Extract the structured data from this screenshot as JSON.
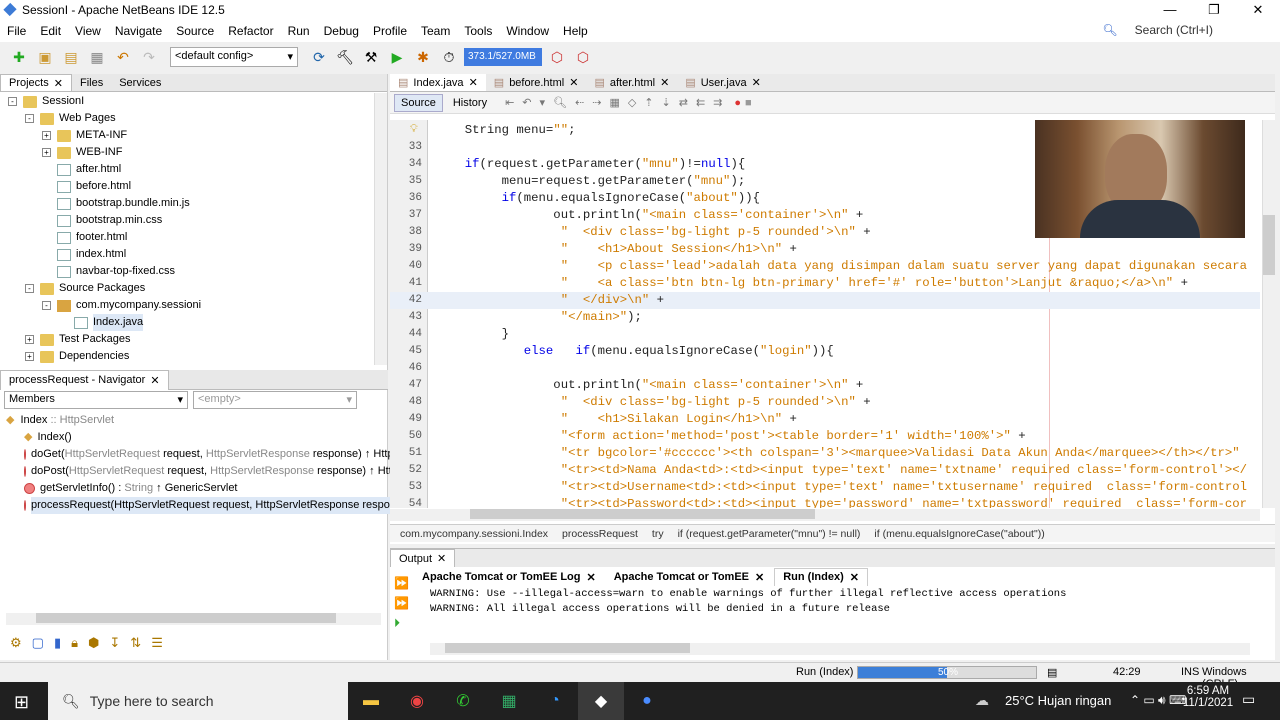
{
  "window": {
    "title": "SessionI - Apache NetBeans IDE 12.5"
  },
  "menu": [
    "File",
    "Edit",
    "View",
    "Navigate",
    "Source",
    "Refactor",
    "Run",
    "Debug",
    "Profile",
    "Team",
    "Tools",
    "Window",
    "Help"
  ],
  "search_placeholder": "Search (Ctrl+I)",
  "toolbar": {
    "config": "<default config>",
    "memory": "373.1/527.0MB"
  },
  "left_tabs": [
    "Projects",
    "Files",
    "Services"
  ],
  "project_tree": [
    {
      "label": "SessionI",
      "level": 0,
      "icon": "project-icon",
      "exp": "-"
    },
    {
      "label": "Web Pages",
      "level": 1,
      "icon": "folder-icon",
      "exp": "-"
    },
    {
      "label": "META-INF",
      "level": 2,
      "icon": "folder-icon",
      "exp": "+"
    },
    {
      "label": "WEB-INF",
      "level": 2,
      "icon": "folder-icon",
      "exp": "+"
    },
    {
      "label": "after.html",
      "level": 2,
      "icon": "file-icon"
    },
    {
      "label": "before.html",
      "level": 2,
      "icon": "file-icon"
    },
    {
      "label": "bootstrap.bundle.min.js",
      "level": 2,
      "icon": "file-icon"
    },
    {
      "label": "bootstrap.min.css",
      "level": 2,
      "icon": "file-icon"
    },
    {
      "label": "footer.html",
      "level": 2,
      "icon": "file-icon"
    },
    {
      "label": "index.html",
      "level": 2,
      "icon": "file-icon"
    },
    {
      "label": "navbar-top-fixed.css",
      "level": 2,
      "icon": "file-icon"
    },
    {
      "label": "Source Packages",
      "level": 1,
      "icon": "folder-icon",
      "exp": "-"
    },
    {
      "label": "com.mycompany.sessioni",
      "level": 2,
      "icon": "package-icon",
      "exp": "-"
    },
    {
      "label": "Index.java",
      "level": 3,
      "icon": "file-icon",
      "selected": true
    },
    {
      "label": "Test Packages",
      "level": 1,
      "icon": "folder-icon",
      "exp": "+"
    },
    {
      "label": "Dependencies",
      "level": 1,
      "icon": "folder-icon",
      "exp": "+"
    }
  ],
  "navigator": {
    "title": "processRequest - Navigator",
    "members_label": "Members",
    "filter": "<empty>",
    "root": {
      "name": "Index",
      "type": ":: HttpServlet"
    },
    "items": [
      {
        "name": "Index()",
        "params": "",
        "rest": ""
      },
      {
        "name": "doGet(",
        "params": "HttpServletRequest",
        "rest": " request, ",
        "params2": "HttpServletResponse",
        "rest2": " response) ↑ HttpServlet"
      },
      {
        "name": "doPost(",
        "params": "HttpServletRequest",
        "rest": " request, ",
        "params2": "HttpServletResponse",
        "rest2": " response) ↑ HttpServlet"
      },
      {
        "name": "getServletInfo() : ",
        "params": "String",
        "rest": " ↑ GenericServlet"
      },
      {
        "name": "processRequest(HttpServletRequest request, HttpServletResponse response)",
        "params": "",
        "rest": "",
        "selected": true
      }
    ]
  },
  "editor_tabs": [
    "Index.java",
    "before.html",
    "after.html",
    "User.java"
  ],
  "editor_modes": {
    "source": "Source",
    "history": "History"
  },
  "code": [
    {
      "n": "",
      "t": "  String menu=\"\";"
    },
    {
      "n": "33",
      "t": ""
    },
    {
      "n": "34",
      "t": "  if(request.getParameter(\"mnu\")!=null){"
    },
    {
      "n": "35",
      "t": "       menu=request.getParameter(\"mnu\");"
    },
    {
      "n": "36",
      "t": "       if(menu.equalsIgnoreCase(\"about\")){"
    },
    {
      "n": "37",
      "t": "              out.println(\"<main class='container'>\\n\" +"
    },
    {
      "n": "38",
      "t": "               \"  <div class='bg-light p-5 rounded'>\\n\" +"
    },
    {
      "n": "39",
      "t": "               \"    <h1>About Session</h1>\\n\" +"
    },
    {
      "n": "40",
      "t": "               \"    <p class='lead'>adalah data yang disimpan dalam suatu server yang dapat digunakan secara"
    },
    {
      "n": "41",
      "t": "               \"    <a class='btn btn-lg btn-primary' href='#' role='button'>Lanjut &raquo;</a>\\n\" +"
    },
    {
      "n": "42",
      "t": "               \"  </div>\\n\" +"
    },
    {
      "n": "43",
      "t": "               \"</main>\");"
    },
    {
      "n": "44",
      "t": "       }"
    },
    {
      "n": "45",
      "t": "          else   if(menu.equalsIgnoreCase(\"login\")){"
    },
    {
      "n": "46",
      "t": ""
    },
    {
      "n": "47",
      "t": "              out.println(\"<main class='container'>\\n\" +"
    },
    {
      "n": "48",
      "t": "               \"  <div class='bg-light p-5 rounded'>\\n\" +"
    },
    {
      "n": "49",
      "t": "               \"    <h1>Silakan Login</h1>\\n\" +"
    },
    {
      "n": "50",
      "t": "               \"<form action='method='post'><table border='1' width='100%'>\" +"
    },
    {
      "n": "51",
      "t": "               \"<tr bgcolor='#cccccc'><th colspan='3'><marquee>Validasi Data Akun Anda</marquee></th></tr>\""
    },
    {
      "n": "52",
      "t": "               \"<tr><td>Nama Anda<td>:<td><input type='text' name='txtname' required class='form-control'></"
    },
    {
      "n": "53",
      "t": "               \"<tr><td>Username<td>:<td><input type='text' name='txtusername' required  class='form-control"
    },
    {
      "n": "54",
      "t": "               \"<tr><td>Password<td>:<td><input type='password' name='txtpassword' required  class='form-cor"
    }
  ],
  "breadcrumb": [
    "com.mycompany.sessioni.Index",
    "processRequest",
    "try",
    "if (request.getParameter(\"mnu\") != null)",
    "if (menu.equalsIgnoreCase(\"about\"))"
  ],
  "output": {
    "title": "Output",
    "tabs": [
      "Apache Tomcat or TomEE Log",
      "Apache Tomcat or TomEE",
      "Run (Index)"
    ],
    "lines": [
      "WARNING: Use --illegal-access=warn to enable warnings of further illegal reflective access operations",
      "WARNING: All illegal access operations will be denied in a future release"
    ]
  },
  "status": {
    "task": "Run (Index)",
    "progress_percent": 50,
    "progress_label": "50%",
    "position": "42:29",
    "mode": "INS",
    "line_endings": "Windows (CRLF)"
  },
  "taskbar": {
    "search": "Type here to search",
    "weather": "25°C  Hujan ringan",
    "time": "6:59 AM",
    "date": "11/1/2021"
  }
}
